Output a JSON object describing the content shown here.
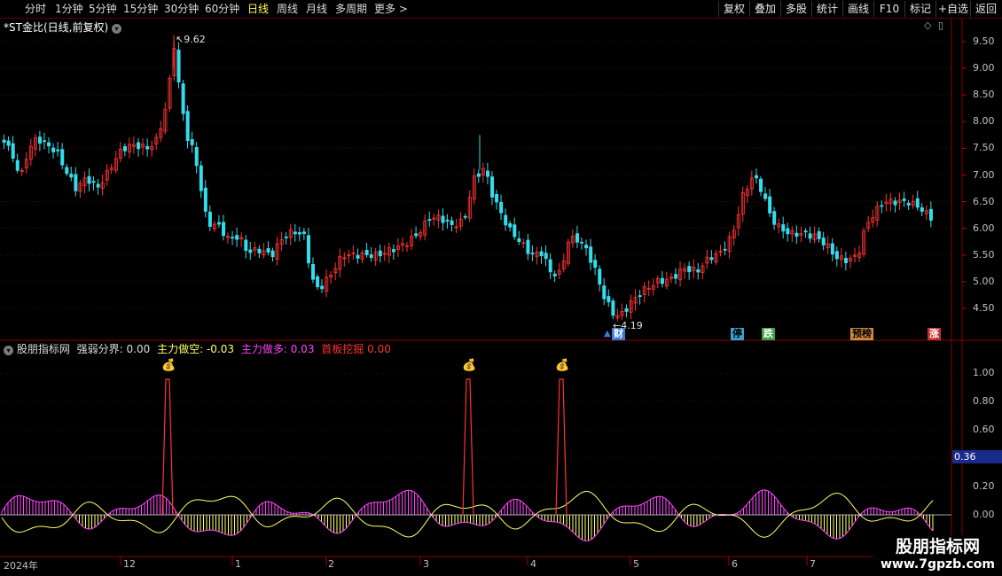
{
  "toolbar": {
    "periods": [
      "分时",
      "1分钟",
      "5分钟",
      "15分钟",
      "30分钟",
      "60分钟",
      "日线",
      "周线",
      "月线",
      "多周期",
      "更多 >"
    ],
    "active_period": "日线",
    "buttons": [
      "复权",
      "叠加",
      "多股",
      "统计",
      "画线",
      "F10",
      "标记",
      "+自选",
      "返回"
    ]
  },
  "main_chart": {
    "title": "*ST金比(日线,前复权)",
    "high_marker": "9.62",
    "low_marker": "4.19",
    "price_ticks": [
      "9.50",
      "9.00",
      "8.50",
      "8.00",
      "7.50",
      "7.00",
      "6.50",
      "6.00",
      "5.50",
      "5.00",
      "4.50"
    ],
    "badges": [
      {
        "text": "财",
        "color": "#3a7ad0",
        "text_color": "#ffffff"
      },
      {
        "text": "停",
        "color": "#3aa0d0",
        "text_color": "#000000"
      },
      {
        "text": "跌",
        "color": "#3aa040",
        "text_color": "#ffffff"
      },
      {
        "text": "预榜",
        "color": "#d08a3a",
        "text_color": "#000000"
      },
      {
        "text": "涨",
        "color": "#c03030",
        "text_color": "#ffffff"
      }
    ]
  },
  "indicator": {
    "name": "股朋指标网",
    "fields": [
      {
        "label": "强弱分界:",
        "value": "0.00",
        "color": "#dcdcdc"
      },
      {
        "label": "主力做空:",
        "value": "-0.03",
        "color": "#ffff66"
      },
      {
        "label": "主力做多:",
        "value": "0.03",
        "color": "#ff44ff"
      },
      {
        "label": "首板挖掘",
        "value": "0.00",
        "color": "#ff3333"
      }
    ],
    "ticks": [
      "1.00",
      "0.80",
      "0.60",
      "0.20",
      "0.00"
    ],
    "current_value": "0.36"
  },
  "date_axis": [
    "2024年",
    "12",
    "1",
    "2",
    "3",
    "4",
    "5",
    "6",
    "7"
  ],
  "watermark": {
    "line1": "股朋指标网",
    "line2": "www.7gpzb.com"
  },
  "colors": {
    "up": "#ff3333",
    "down": "#33ddee",
    "grid": "#8a0000"
  }
}
